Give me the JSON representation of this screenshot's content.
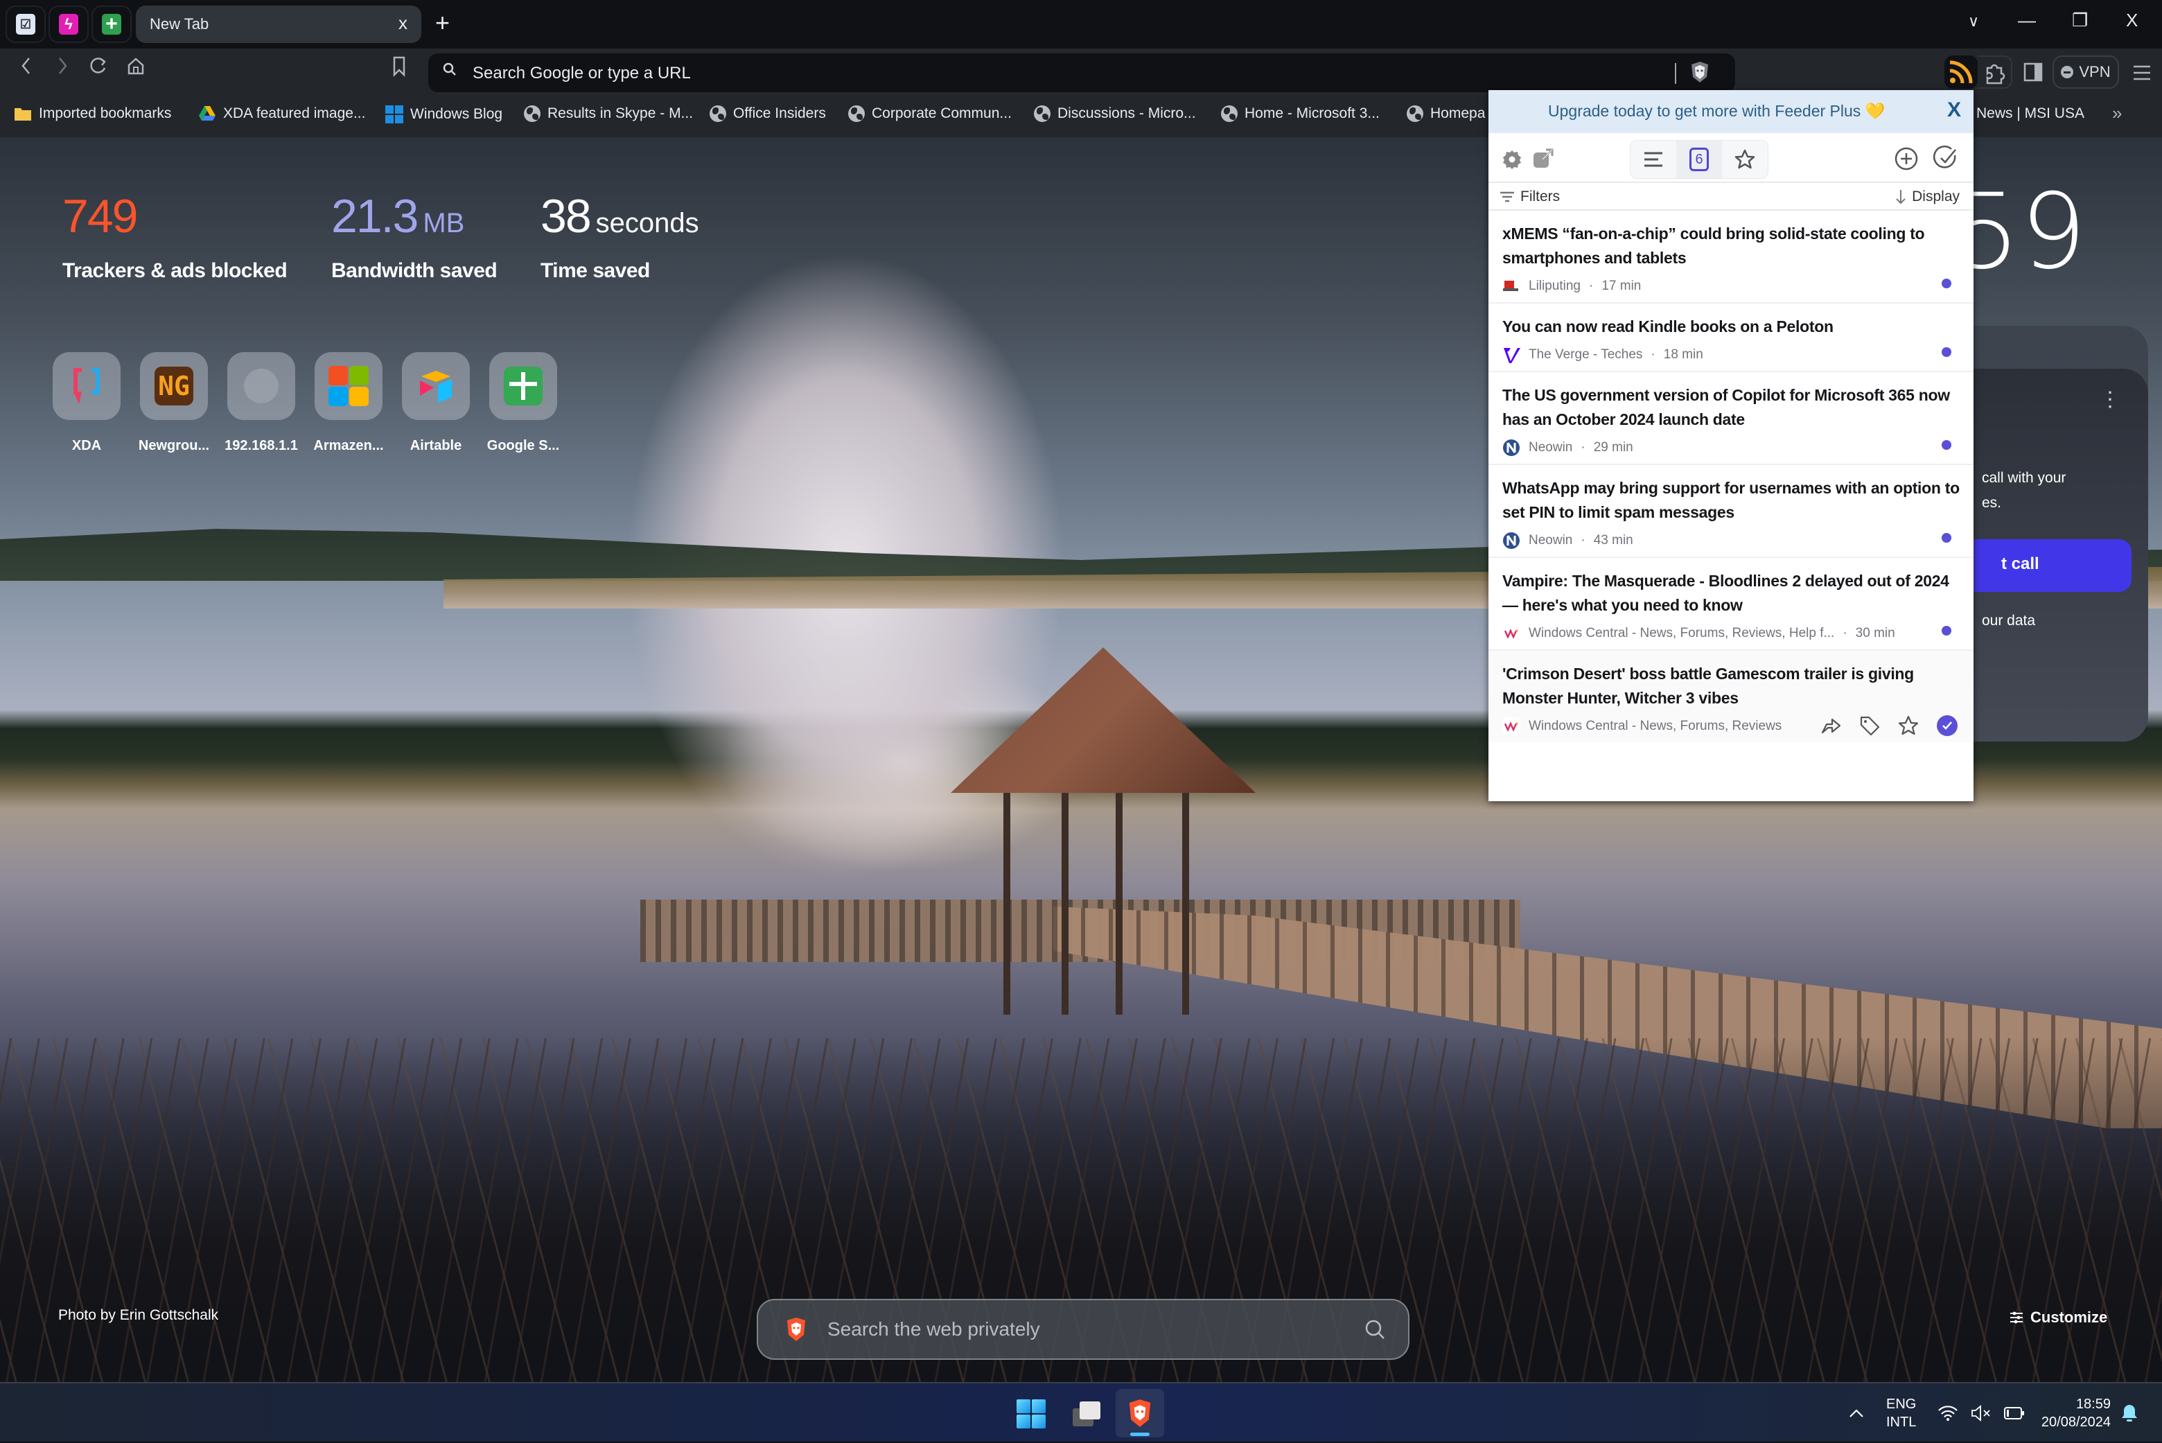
{
  "browser": {
    "pinned_tabs": [
      {
        "name": "todo-app",
        "color": "#dfe6f4",
        "glyph": "☑"
      },
      {
        "name": "lightning-app",
        "color": "#e21fb4",
        "glyph": "ϟ"
      },
      {
        "name": "google-sheets",
        "color": "#2ea04f",
        "glyph": "+"
      }
    ],
    "active_tab": {
      "title": "New Tab",
      "close_glyph": "x"
    },
    "new_tab_glyph": "+",
    "window_controls": {
      "tab_search": "∨",
      "minimize": "—",
      "restore": "❐",
      "close": "X"
    },
    "address_bar": {
      "placeholder": "Search Google or type a URL"
    },
    "vpn_label": "VPN",
    "bookmarks": [
      {
        "label": "Imported bookmarks",
        "icon": "folder-icon"
      },
      {
        "label": "XDA featured image...",
        "icon": "google-drive-icon"
      },
      {
        "label": "Windows Blog",
        "icon": "windows-icon"
      },
      {
        "label": "Results in Skype - M...",
        "icon": "globe-icon"
      },
      {
        "label": "Office Insiders",
        "icon": "globe-icon"
      },
      {
        "label": "Corporate Commun...",
        "icon": "globe-icon"
      },
      {
        "label": "Discussions - Micro...",
        "icon": "globe-icon"
      },
      {
        "label": "Home - Microsoft 3...",
        "icon": "globe-icon"
      },
      {
        "label": "Homepa",
        "icon": "globe-icon"
      },
      {
        "label": "News | MSI USA",
        "icon": "none"
      }
    ],
    "bookmarks_overflow": "»"
  },
  "new_tab": {
    "stats": [
      {
        "value": "749",
        "unit": "",
        "label": "Trackers & ads blocked",
        "color": "#fb542b"
      },
      {
        "value": "21.3",
        "unit": "MB",
        "label": "Bandwidth saved",
        "color": "#a0a5eb"
      },
      {
        "value": "38",
        "unit": "seconds",
        "label": "Time saved",
        "color": "#ffffff"
      }
    ],
    "top_sites": [
      {
        "label": "XDA"
      },
      {
        "label": "Newgrou..."
      },
      {
        "label": "192.168.1.1"
      },
      {
        "label": "Armazen..."
      },
      {
        "label": "Airtable"
      },
      {
        "label": "Google S..."
      }
    ],
    "clock_partial": "59",
    "widget": {
      "desc_line1": "call with your",
      "desc_line2": "es.",
      "cta_label": "t call",
      "note": "our data"
    },
    "photo_credit": "Photo by Erin Gottschalk",
    "search_placeholder": "Search the web privately",
    "customize_label": "Customize"
  },
  "feeder": {
    "banner_text": "Upgrade today to get more with Feeder Plus 💛",
    "banner_close": "X",
    "unread_count": "6",
    "filters_label": "Filters",
    "display_label": "Display",
    "accent": "#5a4fd6",
    "items": [
      {
        "title": "xMEMS “fan-on-a-chip” could bring solid-state cooling to smartphones and tablets",
        "source": "Liliputing",
        "age": "17 min",
        "unread": true
      },
      {
        "title": "You can now read Kindle books on a Peloton",
        "source": "The Verge - Teches",
        "age": "18 min",
        "unread": true
      },
      {
        "title": "The US government version of Copilot for Microsoft 365 now has an October 2024 launch date",
        "source": "Neowin",
        "age": "29 min",
        "unread": true
      },
      {
        "title": "WhatsApp may bring support for usernames with an option to set PIN to limit spam messages",
        "source": "Neowin",
        "age": "43 min",
        "unread": true
      },
      {
        "title": "Vampire: The Masquerade - Bloodlines 2 delayed out of 2024 — here's what you need to know",
        "source": "Windows Central - News, Forums, Reviews, Help f...",
        "age": "30 min",
        "unread": true
      },
      {
        "title": "'Crimson Desert' boss battle Gamescom trailer is giving Monster Hunter, Witcher 3 vibes",
        "source": "Windows Central - News, Forums, Reviews",
        "age": "",
        "unread": true
      }
    ]
  },
  "taskbar": {
    "lang_line1": "ENG",
    "lang_line2": "INTL",
    "time": "18:59",
    "date": "20/08/2024"
  }
}
